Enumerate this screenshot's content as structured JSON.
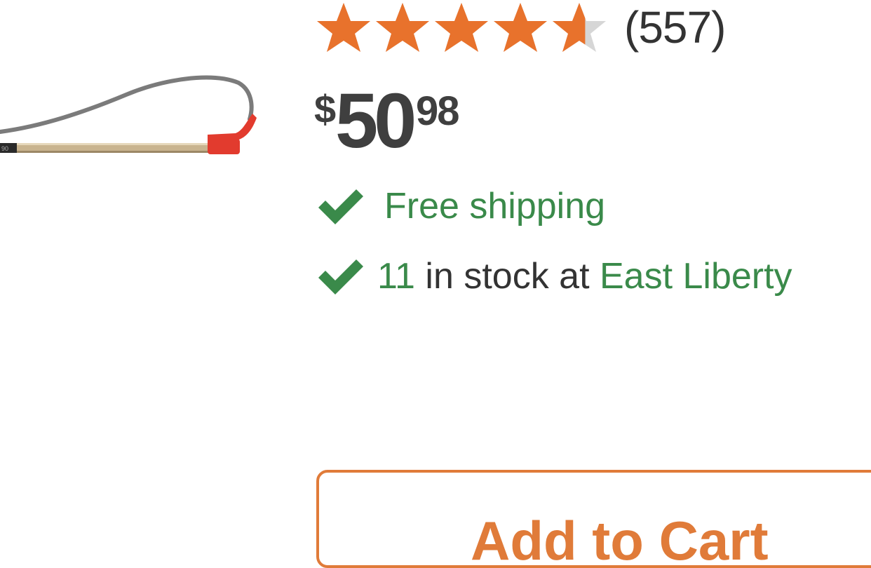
{
  "product": {
    "image_alt": "fish gaff tool"
  },
  "rating": {
    "stars_value": 4.6,
    "stars_max": 5,
    "review_count": "(557)",
    "star_color": "#e8722c",
    "star_empty_color": "#d6d6d6"
  },
  "price": {
    "currency": "$",
    "dollars": "50",
    "cents": "98",
    "color": "#3f3f3f"
  },
  "shipping": {
    "label": "Free shipping",
    "icon": "checkmark-icon",
    "color": "#3a8a4a"
  },
  "stock": {
    "count": "11",
    "middle_text": " in stock at ",
    "store_name": "East Liberty",
    "icon": "checkmark-icon"
  },
  "actions": {
    "add_to_cart_label": "Add to Cart",
    "accent_color": "#e07b39"
  }
}
